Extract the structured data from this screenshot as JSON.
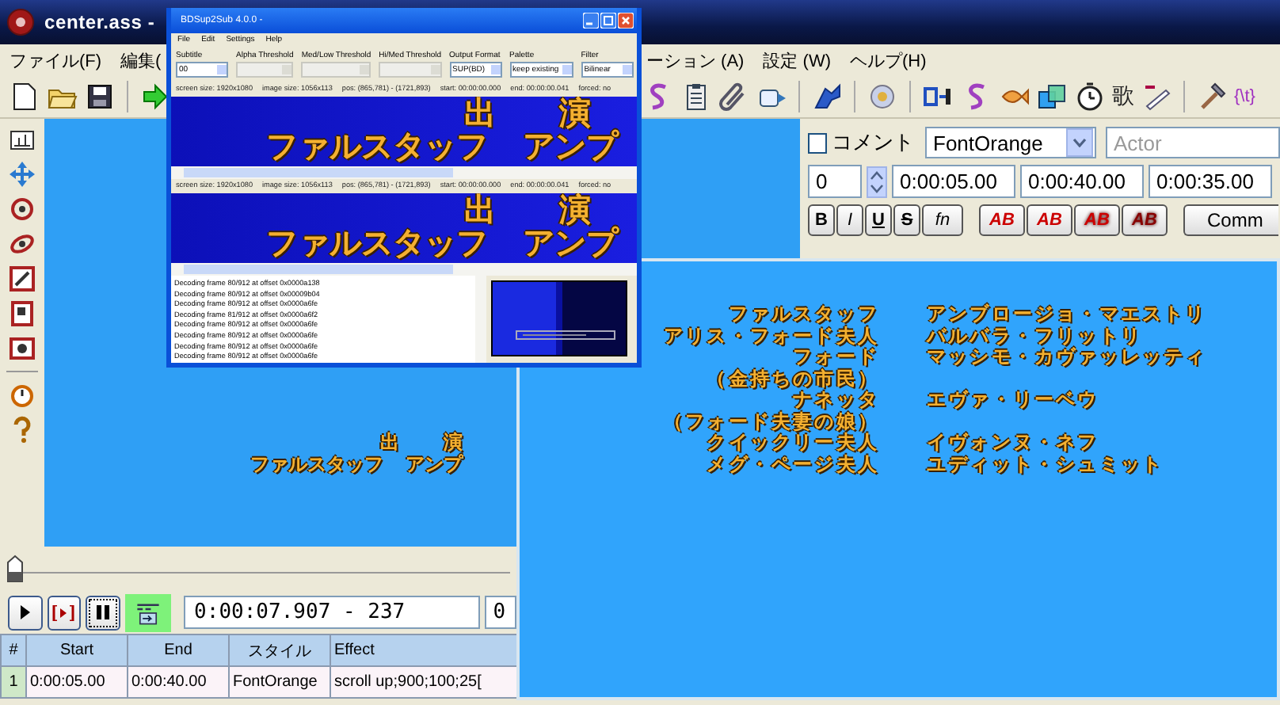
{
  "window": {
    "title": "center.ass -"
  },
  "menu": [
    "ファイル(F)",
    "編集(",
    "ーション (A)",
    "設定 (W)",
    "ヘルプ(H)"
  ],
  "toolbar": {
    "glyph": "歌",
    "tag": "{\\t}"
  },
  "video": {
    "top": [
      "出",
      "演"
    ],
    "bottom": [
      "ファルスタッフ",
      "アンプ"
    ]
  },
  "editor": {
    "comment": false,
    "comment_label": "コメント",
    "style": "FontOrange",
    "actor_placeholder": "Actor",
    "layer": "0",
    "start": "0:00:05.00",
    "end": "0:00:40.00",
    "duration": "0:00:35.00",
    "format_buttons": [
      "B",
      "I",
      "U",
      "S",
      "fn"
    ],
    "color_buttons": [
      "AB",
      "AB",
      "AB",
      "AB"
    ],
    "commit": "Comm"
  },
  "seek": {
    "level": 0
  },
  "playback": {
    "time": "0:00:07.907 - 237",
    "next": "0"
  },
  "grid": {
    "columns": [
      "#",
      "Start",
      "End",
      "スタイル",
      "Effect"
    ],
    "rows": [
      {
        "cells": [
          "1",
          "0:00:05.00",
          "0:00:40.00",
          "FontOrange",
          "scroll up;900;100;25["
        ]
      }
    ]
  },
  "preview": {
    "credits": [
      {
        "role": "ファルスタッフ",
        "actor": "アンブロージョ・マエストリ"
      },
      {
        "role": "アリス・フォード夫人",
        "actor": "バルバラ・フリットリ"
      },
      {
        "role": "フォード",
        "actor": "マッシモ・カヴァッレッティ"
      },
      {
        "role": "（金持ちの市民）"
      },
      {
        "role": "ナネッタ",
        "actor": "エヴァ・リーベウ"
      },
      {
        "role": "（フォード夫妻の娘）"
      },
      {
        "role": "クイックリー夫人",
        "actor": "イヴォンヌ・ネフ"
      },
      {
        "role": "メグ・ページ夫人",
        "actor": "ユディット・シュミット"
      }
    ]
  },
  "converter": {
    "title": "BDSup2Sub 4.0.0 -",
    "menu": [
      "File",
      "Edit",
      "Settings",
      "Help"
    ],
    "options": [
      {
        "label": "Subtitle",
        "value": "00",
        "disabled": false
      },
      {
        "label": "Alpha Threshold",
        "disabled": true
      },
      {
        "label": "Med/Low Threshold",
        "disabled": true
      },
      {
        "label": "Hi/Med Threshold",
        "disabled": true
      },
      {
        "label": "Output Format",
        "value": "SUP(BD)",
        "disabled": false
      },
      {
        "label": "Palette",
        "value": "keep existing",
        "disabled": false
      },
      {
        "label": "Filter",
        "value": "Bilinear",
        "disabled": false
      }
    ],
    "frames": [
      {
        "info": [
          "screen size: 1920x1080",
          "image size: 1056x113",
          "pos: (865,781) - (1721,893)",
          "start: 00:00:00.000",
          "end: 00:00:00.041",
          "forced: no"
        ],
        "top": [
          "出",
          "演"
        ],
        "bottom": [
          "ファルスタッフ",
          "アンプ"
        ]
      },
      {
        "info": [
          "screen size: 1920x1080",
          "image size: 1056x113",
          "pos: (865,781) - (1721,893)",
          "start: 00:00:00.000",
          "end: 00:00:00.041",
          "forced: no"
        ],
        "top": [
          "出",
          "演"
        ],
        "bottom": [
          "ファルスタッフ",
          "アンプ"
        ]
      }
    ],
    "log": [
      "Decoding frame 80/912 at offset 0x0000a138",
      "Decoding frame 80/912 at offset 0x00009b04",
      "Decoding frame 80/912 at offset 0x0000a6fe",
      "Decoding frame 81/912 at offset 0x0000a6f2",
      "Decoding frame 80/912 at offset 0x0000a6fe",
      "Decoding frame 80/912 at offset 0x0000a6fe",
      "Decoding frame 80/912 at offset 0x0000a6fe",
      "Decoding frame 80/912 at offset 0x0000a6fe"
    ]
  }
}
